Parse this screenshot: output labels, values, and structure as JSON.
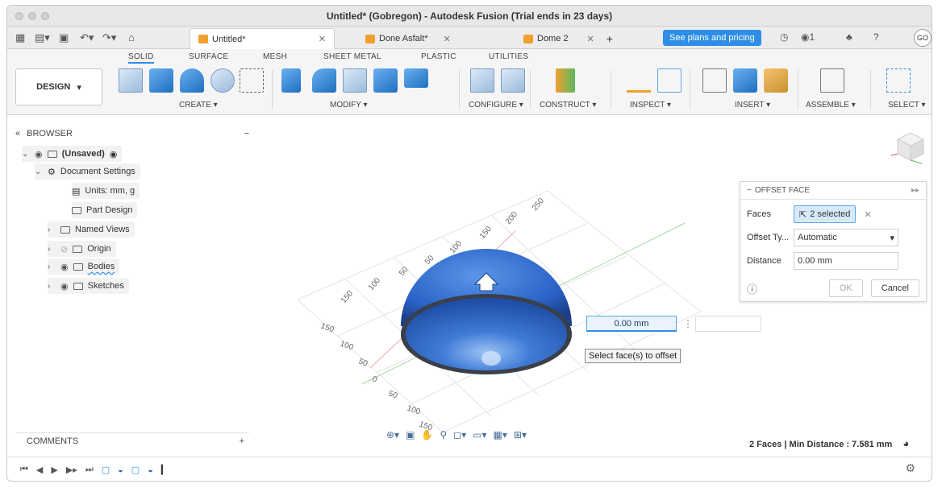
{
  "window": {
    "title": "Untitled* (Gobregon) - Autodesk Fusion (Trial ends in 23 days)"
  },
  "tabs": [
    {
      "label": "Untitled*",
      "active": true
    },
    {
      "label": "Done Asfalt*",
      "active": false
    },
    {
      "label": "Dome 2",
      "active": false
    }
  ],
  "header": {
    "plans_button": "See plans and pricing",
    "notif_count": "1",
    "avatar_initials": "GO"
  },
  "ribbon": {
    "workspace": "DESIGN",
    "tabs": [
      "SOLID",
      "SURFACE",
      "MESH",
      "SHEET METAL",
      "PLASTIC",
      "UTILITIES"
    ],
    "active_tab": "SOLID",
    "groups": [
      "CREATE",
      "MODIFY",
      "CONFIGURE",
      "CONSTRUCT",
      "INSPECT",
      "INSERT",
      "ASSEMBLE",
      "SELECT"
    ]
  },
  "browser": {
    "title": "BROWSER",
    "items": [
      {
        "label": "(Unsaved)"
      },
      {
        "label": "Document Settings"
      },
      {
        "label": "Units: mm, g"
      },
      {
        "label": "Part Design"
      },
      {
        "label": "Named Views"
      },
      {
        "label": "Origin"
      },
      {
        "label": "Bodies"
      },
      {
        "label": "Sketches"
      }
    ]
  },
  "comments": {
    "label": "COMMENTS",
    "add": "+"
  },
  "offset_face": {
    "title": "OFFSET FACE",
    "faces_label": "Faces",
    "faces_value": "2 selected",
    "offset_type_label": "Offset Ty...",
    "offset_type_value": "Automatic",
    "distance_label": "Distance",
    "distance_value": "0.00 mm",
    "ok_label": "OK",
    "cancel_label": "Cancel"
  },
  "viewport": {
    "inline_value": "0.00 mm",
    "tooltip": "Select face(s) to offset",
    "grid_labels_back": [
      "250",
      "200",
      "150",
      "100",
      "50",
      "50",
      "100",
      "150"
    ],
    "grid_labels_front": [
      "150",
      "100",
      "50",
      "0",
      "50",
      "100",
      "150"
    ]
  },
  "status": {
    "text": "2 Faces | Min Distance : 7.581 mm"
  },
  "colors": {
    "accent": "#2d8ee6",
    "dome": "#2a63c7"
  }
}
